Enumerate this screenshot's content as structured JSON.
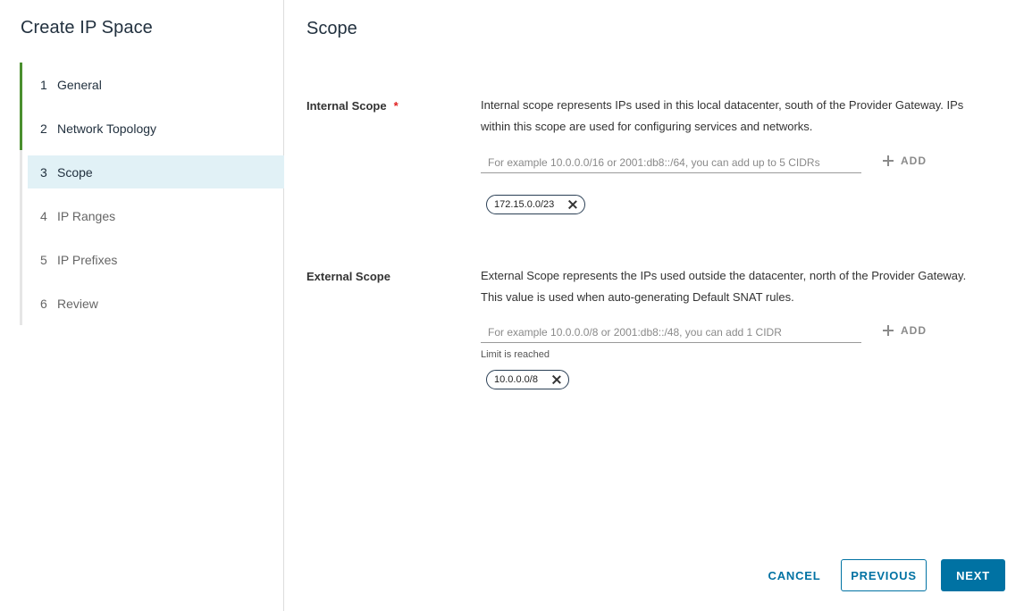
{
  "wizard": {
    "title": "Create IP Space"
  },
  "steps": [
    {
      "num": "1",
      "label": "General"
    },
    {
      "num": "2",
      "label": "Network Topology"
    },
    {
      "num": "3",
      "label": "Scope"
    },
    {
      "num": "4",
      "label": "IP Ranges"
    },
    {
      "num": "5",
      "label": "IP Prefixes"
    },
    {
      "num": "6",
      "label": "Review"
    }
  ],
  "page": {
    "title": "Scope"
  },
  "internal": {
    "label": "Internal Scope",
    "required_mark": "*",
    "description": "Internal scope represents IPs used in this local datacenter, south of the Provider Gateway. IPs within this scope are used for configuring services and networks.",
    "placeholder": "For example 10.0.0.0/16 or 2001:db8::/64, you can add up to 5 CIDRs",
    "add_label": "ADD",
    "chips": [
      "172.15.0.0/23"
    ]
  },
  "external": {
    "label": "External Scope",
    "description": "External Scope represents the IPs used outside the datacenter, north of the Provider Gateway. This value is used when auto-generating Default SNAT rules.",
    "placeholder": "For example 10.0.0.0/8 or 2001:db8::/48, you can add 1 CIDR",
    "add_label": "ADD",
    "hint": "Limit is reached",
    "chips": [
      "10.0.0.0/8"
    ]
  },
  "footer": {
    "cancel": "CANCEL",
    "previous": "PREVIOUS",
    "next": "NEXT"
  },
  "colors": {
    "primary": "#0072a3",
    "completed": "#4b8f2f",
    "current_bg": "#e1f1f6",
    "required": "#e02020"
  }
}
